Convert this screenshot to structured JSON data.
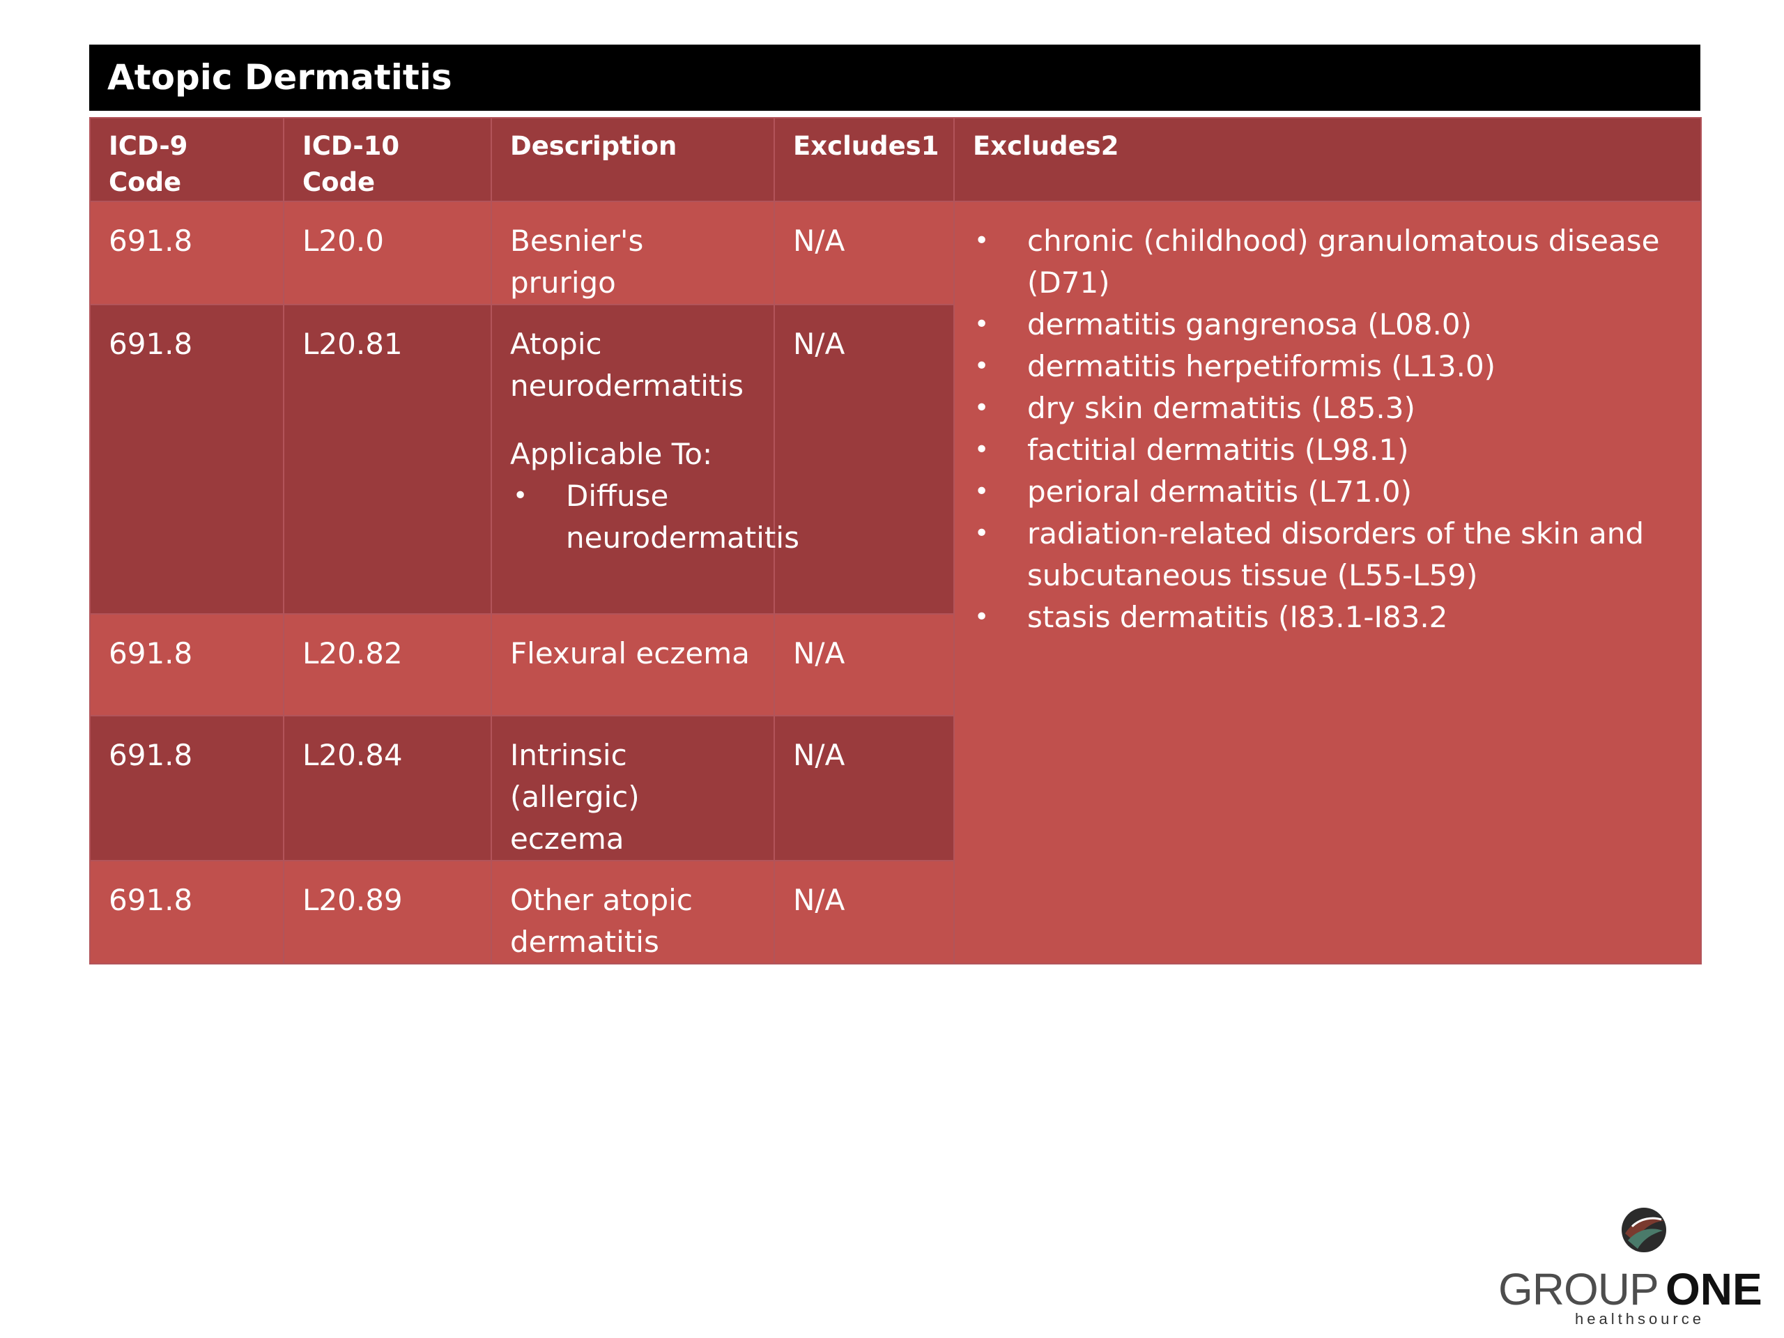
{
  "title": "Atopic Dermatitis",
  "columns": [
    "ICD-9 Code",
    "ICD-10 Code",
    "Description",
    "Excludes1",
    "Excludes2"
  ],
  "rows": [
    {
      "icd9": "691.8",
      "icd10": "L20.0",
      "description": "Besnier's prurigo",
      "excludes1": "N/A"
    },
    {
      "icd9": "691.8",
      "icd10": "L20.81",
      "description": "Atopic neurodermatitis",
      "applicable_to_label": "Applicable To:",
      "applicable_to_items": [
        "Diffuse neurodermatitis"
      ],
      "excludes1": "N/A"
    },
    {
      "icd9": "691.8",
      "icd10": "L20.82",
      "description": "Flexural eczema",
      "excludes1": "N/A"
    },
    {
      "icd9": "691.8",
      "icd10": "L20.84",
      "description": "Intrinsic (allergic) eczema",
      "excludes1": "N/A"
    },
    {
      "icd9": "691.8",
      "icd10": "L20.89",
      "description": "Other atopic dermatitis",
      "excludes1": "N/A"
    }
  ],
  "excludes2": [
    "chronic (childhood) granulomatous disease (D71)",
    "dermatitis gangrenosa (L08.0)",
    "dermatitis herpetiformis (L13.0)",
    "dry skin dermatitis (L85.3)",
    "factitial dermatitis (L98.1)",
    "perioral dermatitis (L71.0)",
    "radiation-related disorders of the skin and subcutaneous tissue (L55-L59)",
    "stasis dermatitis (I83.1-I83.2"
  ],
  "logo": {
    "brand_light": "GROUP",
    "brand_bold": "ONE",
    "tagline": "healthsource"
  },
  "colors": {
    "title_bar": "#000000",
    "row_light": "#c0504d",
    "row_dark": "#9a3b3d",
    "header": "#9a3b3d",
    "text": "#ffffff"
  }
}
